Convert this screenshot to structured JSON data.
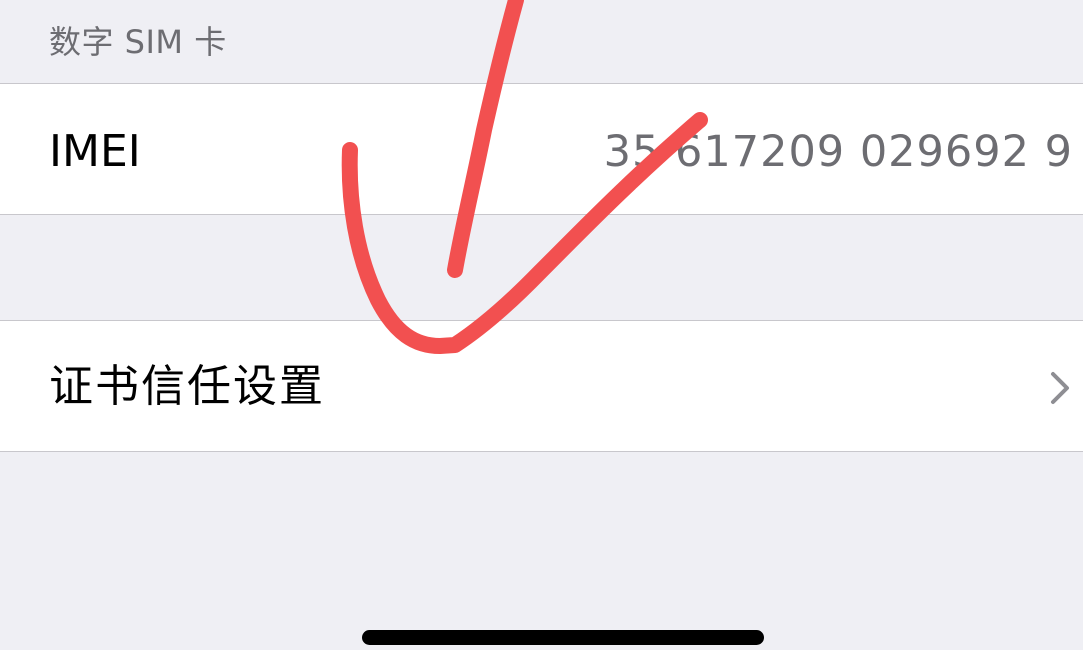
{
  "section_header": {
    "label": "数字 SIM 卡"
  },
  "imei_row": {
    "label": "IMEI",
    "value": "35 617209 029692 9"
  },
  "certificate_row": {
    "label": "证书信任设置",
    "icon": "chevron-right-icon"
  },
  "annotation": {
    "color": "#f25050",
    "description_icon": "handwritten-arrow-check-icon"
  },
  "colors": {
    "background": "#efeff4",
    "row_background": "#ffffff",
    "separator": "#c8c7cc",
    "secondary_text": "#6d6d72",
    "chevron": "#8e8e93"
  }
}
